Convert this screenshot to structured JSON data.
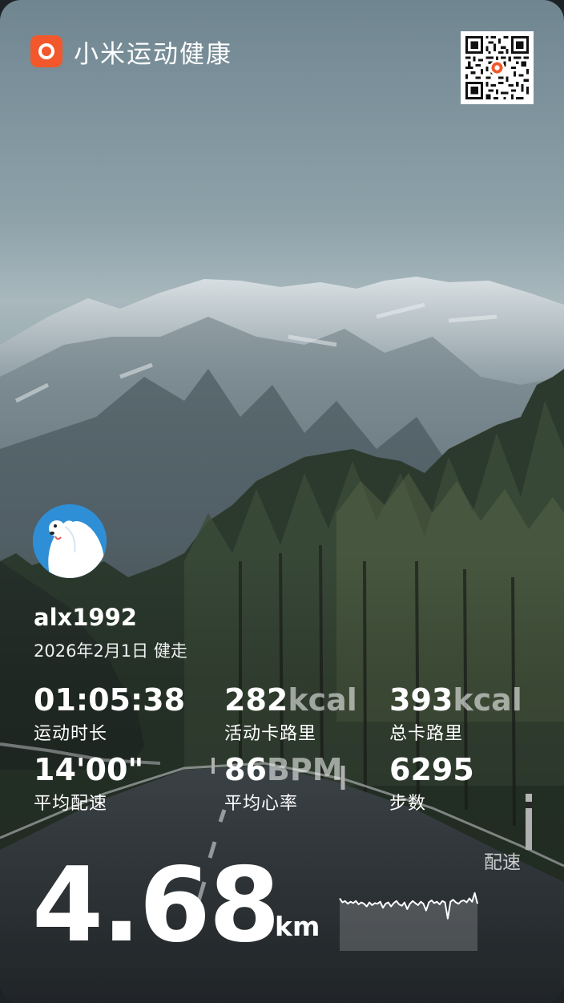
{
  "brand": {
    "name": "小米运动健康",
    "icon": "xiaomi-health-ring-icon",
    "accent": "#f2582b"
  },
  "qr_code": {
    "icon": "qr-code-icon"
  },
  "user": {
    "name": "alx1992",
    "date": "2026年2月1日",
    "activity": "健走",
    "avatar_icon": "polar-bear-avatar-icon"
  },
  "stats": [
    {
      "value": "01:05:38",
      "unit": "",
      "label": "运动时长"
    },
    {
      "value": "282",
      "unit": "kcal",
      "label": "活动卡路里"
    },
    {
      "value": "393",
      "unit": "kcal",
      "label": "总卡路里"
    },
    {
      "value": "14'00\"",
      "unit": "",
      "label": "平均配速"
    },
    {
      "value": "86",
      "unit": "BPM",
      "label": "平均心率"
    },
    {
      "value": "6295",
      "unit": "",
      "label": "步数"
    }
  ],
  "distance": {
    "value": "4.68",
    "unit": "km"
  },
  "pace_chart": {
    "label": "配速",
    "values": [
      0.78,
      0.72,
      0.74,
      0.7,
      0.73,
      0.71,
      0.74,
      0.69,
      0.72,
      0.7,
      0.66,
      0.72,
      0.68,
      0.71,
      0.7,
      0.73,
      0.64,
      0.7,
      0.72,
      0.66,
      0.71,
      0.74,
      0.69,
      0.67,
      0.72,
      0.62,
      0.7,
      0.74,
      0.71,
      0.68,
      0.73,
      0.7,
      0.6,
      0.72,
      0.75,
      0.71,
      0.73,
      0.69,
      0.74,
      0.72,
      0.48,
      0.73,
      0.76,
      0.72,
      0.7,
      0.74,
      0.75,
      0.72,
      0.78,
      0.73,
      0.86,
      0.7
    ]
  }
}
